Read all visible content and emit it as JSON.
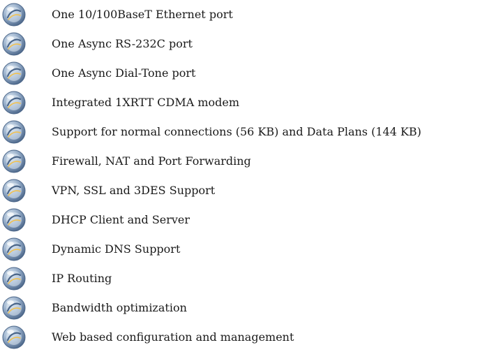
{
  "features": {
    "bullet_icon": "globe-bullet-icon",
    "bullet_colors": {
      "light": "#dce8f3",
      "mid": "#8fa7c4",
      "dark": "#4a6588",
      "accent": "#f2c14e"
    },
    "items": [
      "One 10/100BaseT Ethernet port",
      "One Async RS-232C port",
      "One Async Dial-Tone port",
      "Integrated 1XRTT CDMA modem",
      "Support for normal connections (56 KB) and Data Plans (144 KB)",
      "Firewall, NAT and Port Forwarding",
      "VPN, SSL and 3DES Support",
      "DHCP Client and Server",
      "Dynamic DNS Support",
      "IP Routing",
      "Bandwidth optimization",
      "Web based configuration and management"
    ]
  }
}
